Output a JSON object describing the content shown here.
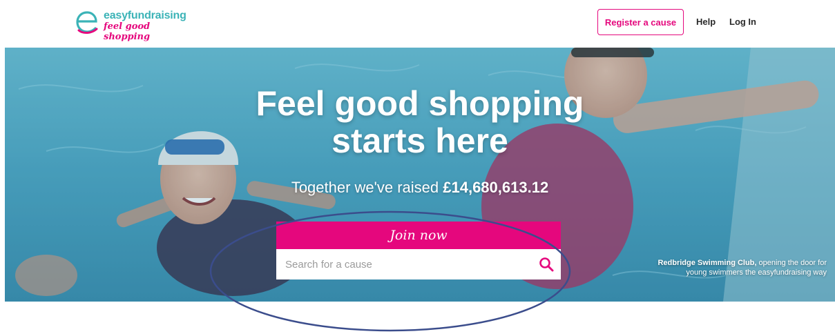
{
  "header": {
    "logo": {
      "name": "easyfundraising",
      "tagline": "feel good shopping",
      "brand_color": "#3bb3b7",
      "accent_color": "#e5077d"
    },
    "register_label": "Register a cause",
    "help_label": "Help",
    "login_label": "Log In"
  },
  "hero": {
    "title_line1": "Feel good shopping",
    "title_line2": "starts here",
    "raised_prefix": "Together we've raised ",
    "raised_amount": "£14,680,613.12",
    "join_label": "Join now",
    "search": {
      "placeholder": "Search for a cause",
      "value": "",
      "icon": "search-icon"
    },
    "caption_name": "Redbridge Swimming Club,",
    "caption_rest_line1": " opening the door for",
    "caption_line2": "young swimmers the easyfundraising way"
  },
  "annotation": {
    "shape": "ellipse",
    "color": "#3b4d8c"
  }
}
